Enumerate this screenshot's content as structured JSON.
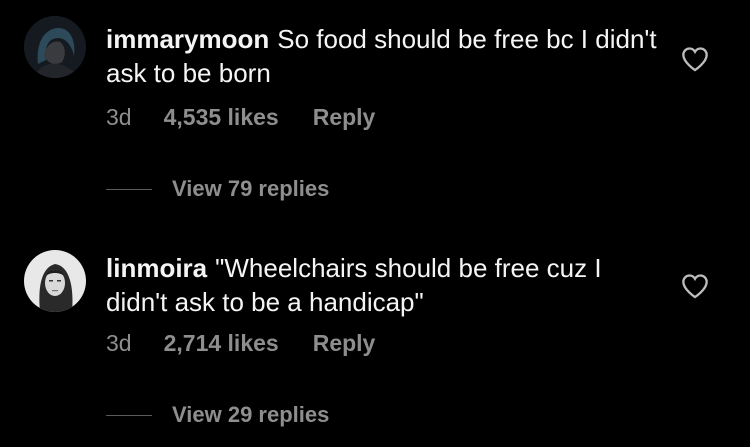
{
  "comments": [
    {
      "username": "immarymoon",
      "text": "So food should be free bc I didn't ask to be born",
      "time": "3d",
      "likes": "4,535 likes",
      "reply_label": "Reply",
      "view_replies": "View 79 replies",
      "avatar_icon": "avatar-blue-hair"
    },
    {
      "username": "linmoira",
      "text": "\"Wheelchairs should be free cuz I didn't ask to be a handicap\"",
      "time": "3d",
      "likes": "2,714 likes",
      "reply_label": "Reply",
      "view_replies": "View 29 replies",
      "avatar_icon": "avatar-sketch-portrait"
    }
  ],
  "colors": {
    "background": "#000000",
    "text": "#f5f5f5",
    "muted": "#8e8e8e"
  },
  "icons": {
    "like": "heart-outline-icon"
  }
}
